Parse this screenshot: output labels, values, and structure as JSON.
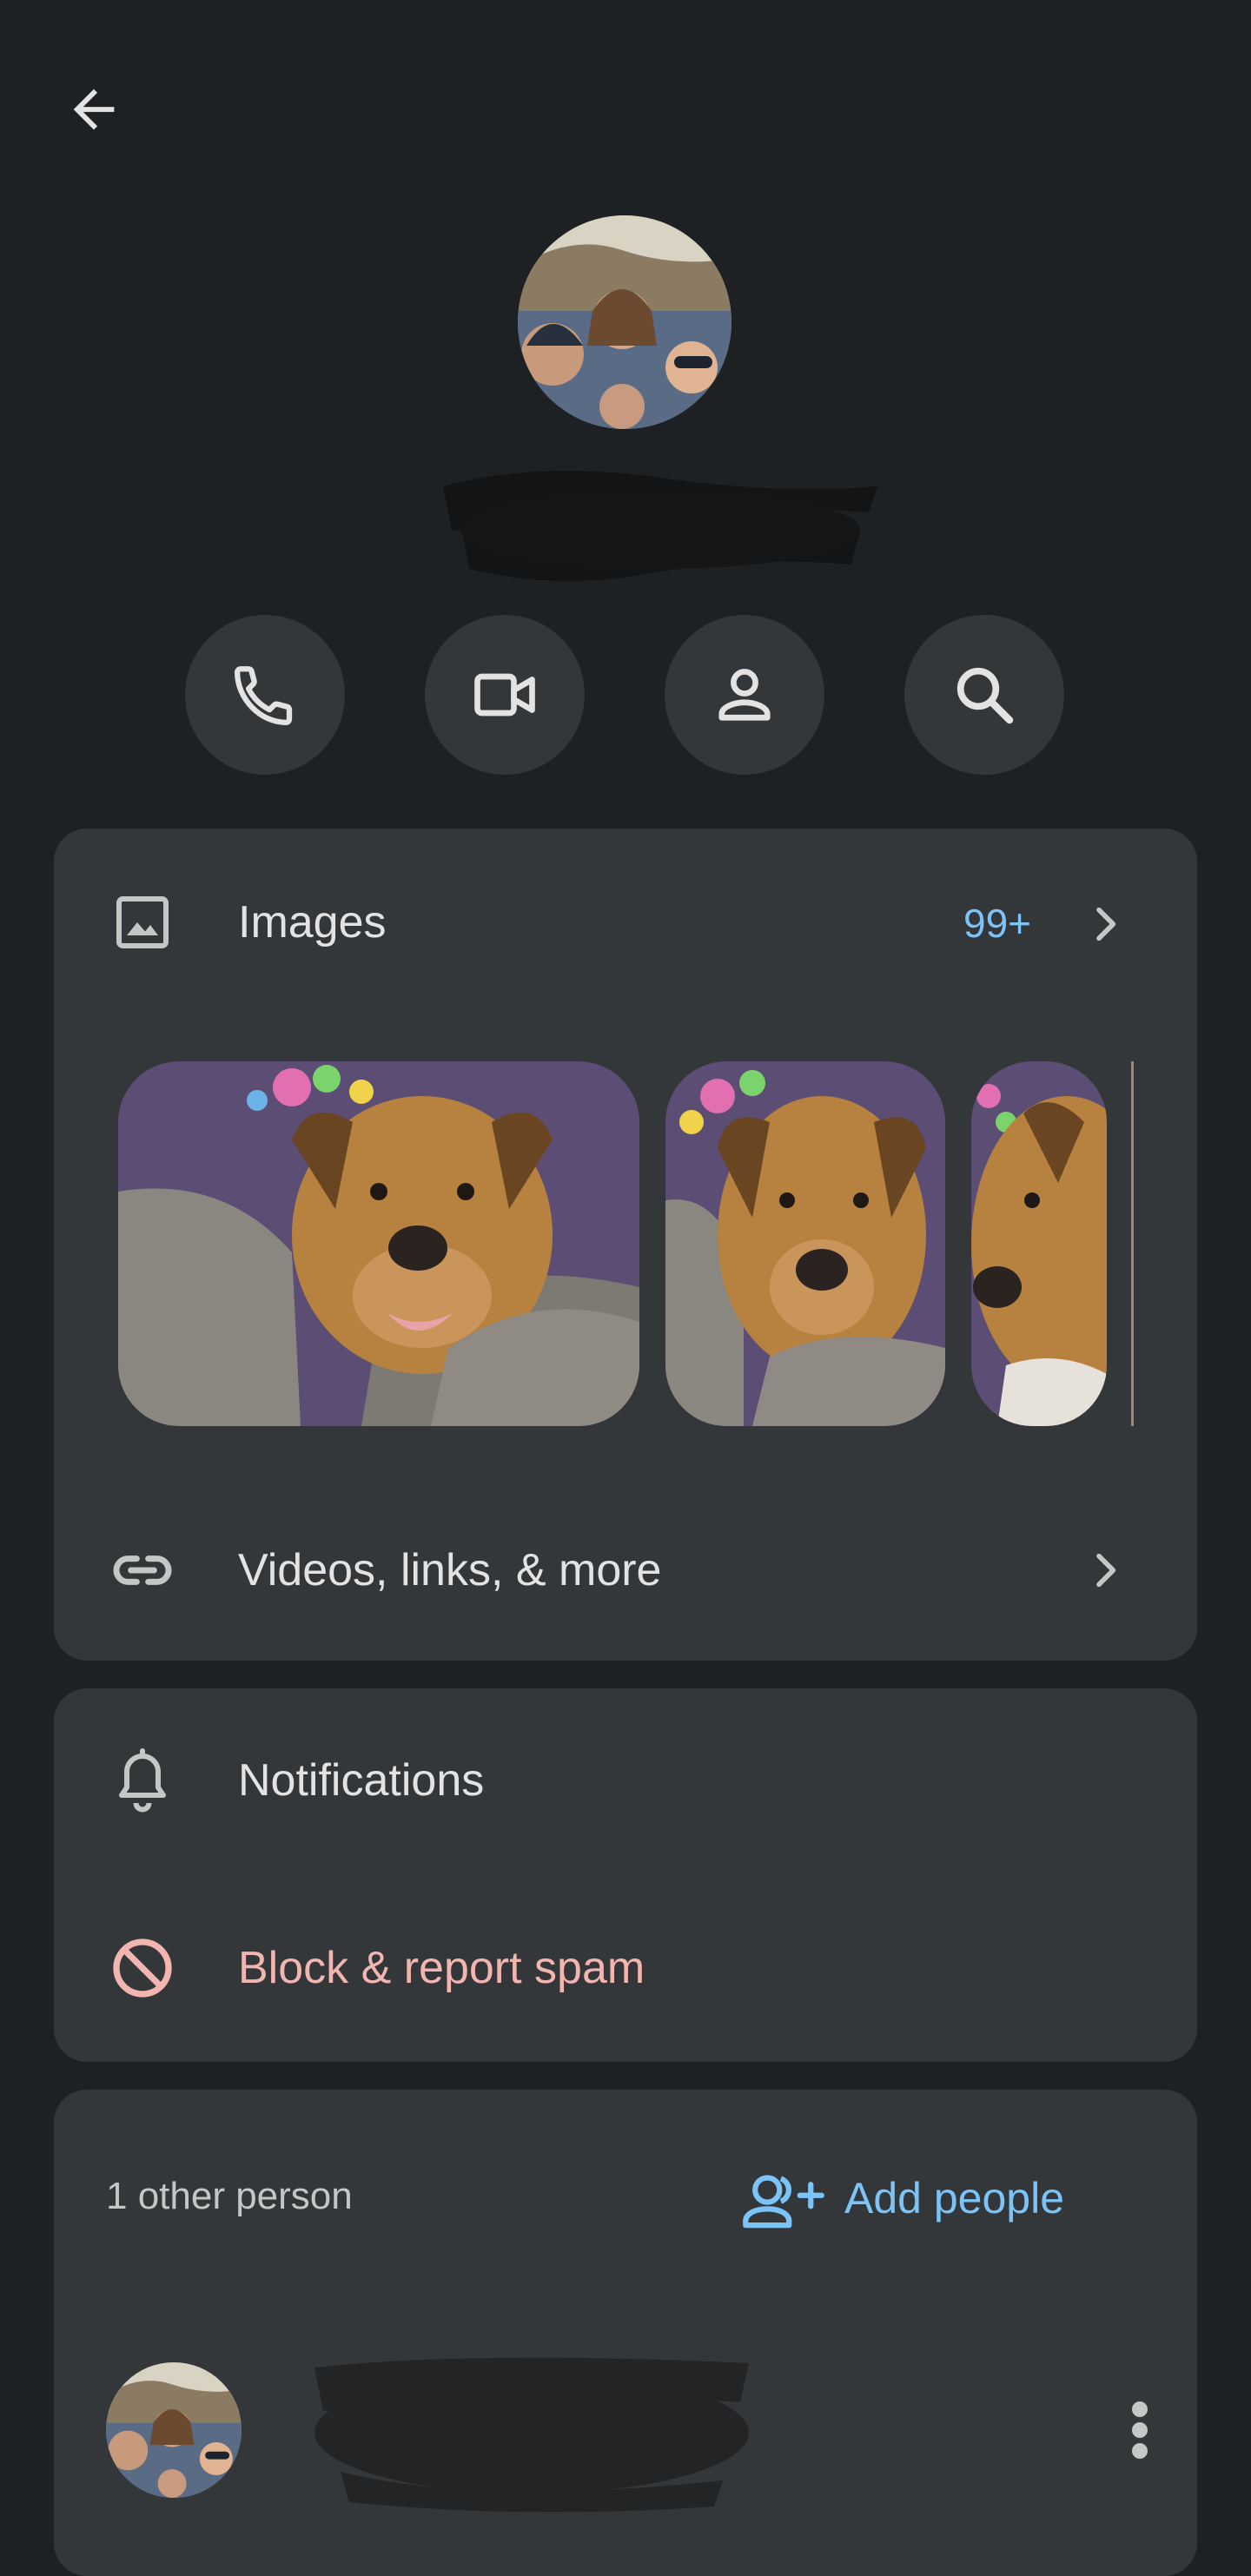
{
  "header": {
    "back_icon": "arrow-back-icon"
  },
  "actions": [
    {
      "icon": "phone-icon"
    },
    {
      "icon": "video-camera-icon"
    },
    {
      "icon": "person-icon"
    },
    {
      "icon": "search-icon"
    }
  ],
  "media": {
    "images_label": "Images",
    "images_count": "99+",
    "more_label": "Videos, links, & more"
  },
  "settings": {
    "notifications_label": "Notifications",
    "block_label": "Block & report spam"
  },
  "people": {
    "count_label": "1 other person",
    "add_label": "Add people"
  },
  "colors": {
    "background": "#1e2124",
    "card": "#33373a",
    "accent": "#7cc4f8",
    "danger": "#f2b5b0"
  }
}
